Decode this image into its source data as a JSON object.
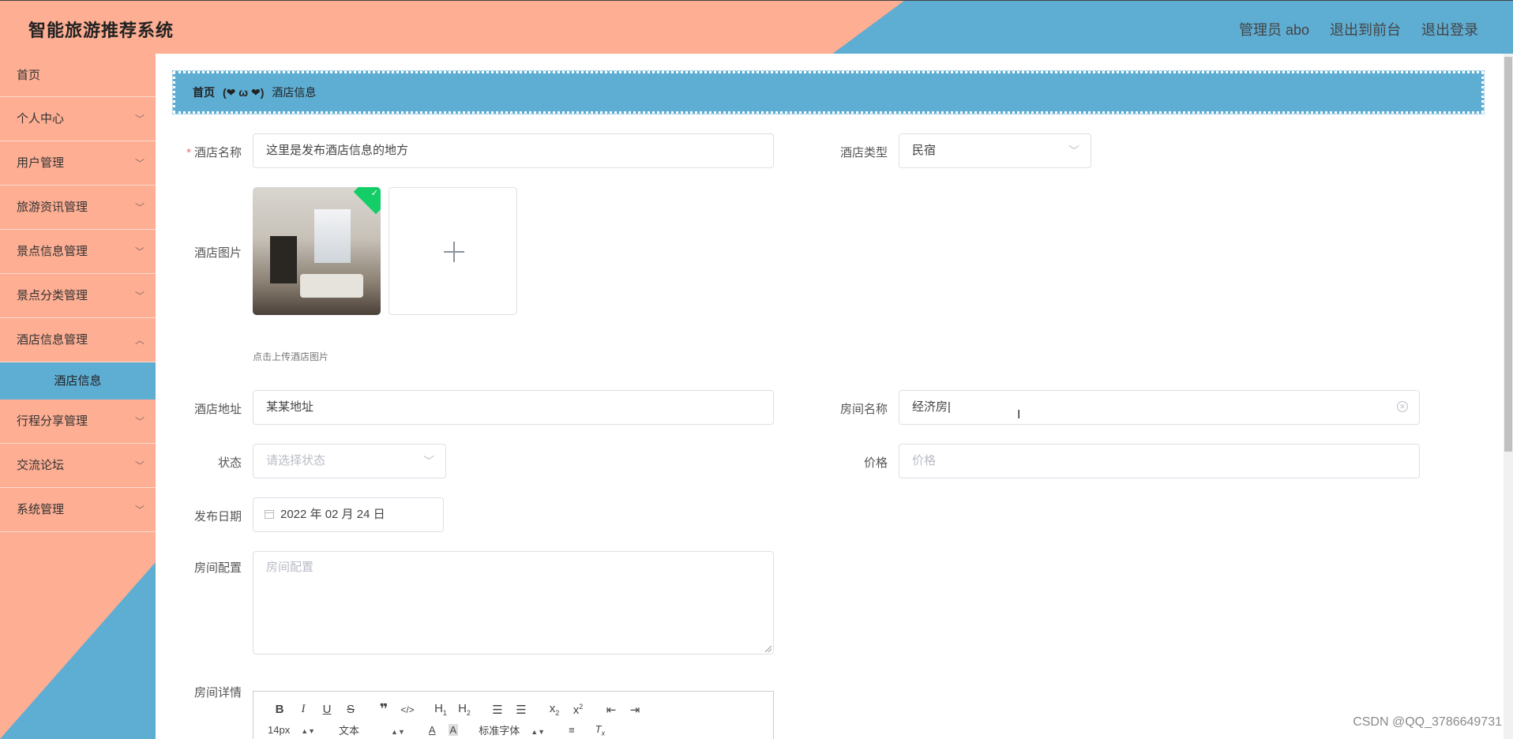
{
  "header": {
    "title": "智能旅游推荐系统",
    "links": [
      "管理员 abo",
      "退出到前台",
      "退出登录"
    ]
  },
  "sidebar": {
    "items": [
      {
        "label": "首页"
      },
      {
        "label": "个人中心"
      },
      {
        "label": "用户管理"
      },
      {
        "label": "旅游资讯管理"
      },
      {
        "label": "景点信息管理"
      },
      {
        "label": "景点分类管理"
      },
      {
        "label": "酒店信息管理"
      },
      {
        "label": "行程分享管理"
      },
      {
        "label": "交流论坛"
      },
      {
        "label": "系统管理"
      }
    ],
    "active_sub": "酒店信息"
  },
  "breadcrumb": {
    "home": "首页",
    "separator": "(❤ ω ❤)",
    "current": "酒店信息"
  },
  "form": {
    "hotel_name": {
      "label": "酒店名称",
      "value": "这里是发布酒店信息的地方"
    },
    "hotel_type": {
      "label": "酒店类型",
      "value": "民宿"
    },
    "hotel_image": {
      "label": "酒店图片",
      "hint": "点击上传酒店图片"
    },
    "hotel_address": {
      "label": "酒店地址",
      "value": "某某地址"
    },
    "room_name": {
      "label": "房间名称",
      "value": "经济房"
    },
    "status": {
      "label": "状态",
      "placeholder": "请选择状态"
    },
    "price": {
      "label": "价格",
      "placeholder": "价格"
    },
    "publish_date": {
      "label": "发布日期",
      "value": "2022 年 02 月 24 日"
    },
    "room_config": {
      "label": "房间配置",
      "placeholder": "房间配置"
    },
    "room_detail": {
      "label": "房间详情"
    }
  },
  "editor": {
    "font_size": "14px",
    "text_type": "文本",
    "font_family": "标准字体"
  },
  "watermark": "CSDN @QQ_3786649731",
  "colors": {
    "salmon": "#fdae93",
    "blue": "#5eadd3",
    "required": "#f56c6c",
    "success": "#13ce66"
  }
}
